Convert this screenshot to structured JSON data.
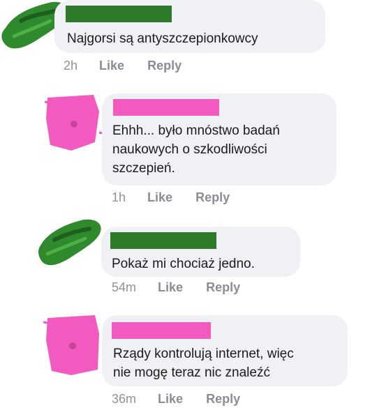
{
  "comments": [
    {
      "text_lines": [
        "Najgorsi są antyszczepionkowcy"
      ],
      "time": "2h",
      "like_label": "Like",
      "reply_label": "Reply",
      "censor_color": "#2f7a2a"
    },
    {
      "text_lines": [
        "Ehhh... było mnóstwo badań",
        "naukowych o szkodliwości",
        "szczepień."
      ],
      "time": "1h",
      "like_label": "Like",
      "reply_label": "Reply",
      "censor_color": "#f25ac0"
    },
    {
      "text_lines": [
        "Pokaż mi chociaż jedno."
      ],
      "time": "54m",
      "like_label": "Like",
      "reply_label": "Reply",
      "censor_color": "#2f7a2a"
    },
    {
      "text_lines": [
        "Rządy kontrolują internet, więc",
        "nie mogę teraz nic znaleźć"
      ],
      "time": "36m",
      "like_label": "Like",
      "reply_label": "Reply",
      "censor_color": "#f25ac0"
    }
  ]
}
